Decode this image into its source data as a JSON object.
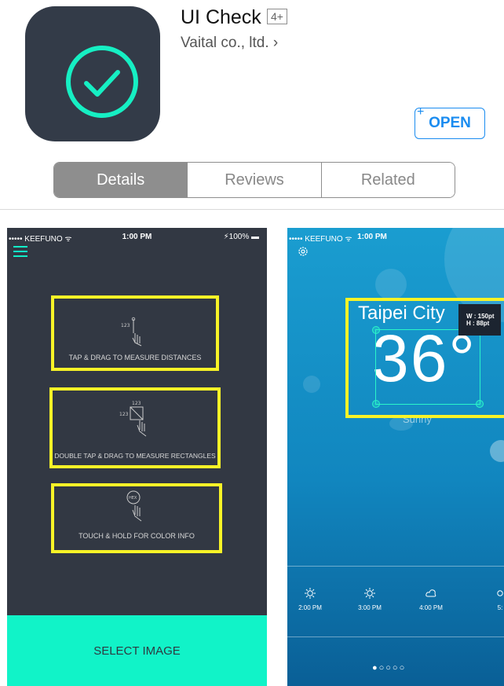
{
  "app": {
    "title": "UI Check",
    "age_rating": "4+",
    "developer": "Vaital co., ltd. ›",
    "open_label": "OPEN",
    "open_plus": "+"
  },
  "tabs": [
    {
      "label": "Details",
      "active": true
    },
    {
      "label": "Reviews",
      "active": false
    },
    {
      "label": "Related",
      "active": false
    }
  ],
  "screenshot1": {
    "status": {
      "carrier": "••••• KEEFUNO ᯤ",
      "time": "1:00 PM",
      "battery": "⚡100% ▬"
    },
    "tips": [
      {
        "label": "TAP & DRAG TO MEASURE DISTANCES",
        "icon_text": "123"
      },
      {
        "label": "DOUBLE TAP & DRAG TO MEASURE RECTANGLES",
        "icon_text": "123"
      },
      {
        "label": "TOUCH & HOLD FOR COLOR INFO",
        "icon_text": "HEX"
      }
    ],
    "select_button": "SELECT IMAGE"
  },
  "screenshot2": {
    "status": {
      "carrier": "••••• KEEFUNO ᯤ",
      "time": "1:00 PM"
    },
    "city": "Taipei City",
    "temperature": "36°",
    "condition": "Sunny",
    "measure": {
      "w": "W : 150pt",
      "h": "H : 88pt"
    },
    "hours": [
      {
        "time": "2:00 PM",
        "icon": "sun-icon"
      },
      {
        "time": "3:00 PM",
        "icon": "sun-icon"
      },
      {
        "time": "4:00 PM",
        "icon": "cloud-icon"
      },
      {
        "time": "5:",
        "icon": "sun-icon"
      }
    ],
    "pager": "●○○○○"
  },
  "colors": {
    "accent": "#11f3c8",
    "highlight": "#f8f327",
    "link": "#1a8cf0",
    "dark_panel": "#323843"
  }
}
